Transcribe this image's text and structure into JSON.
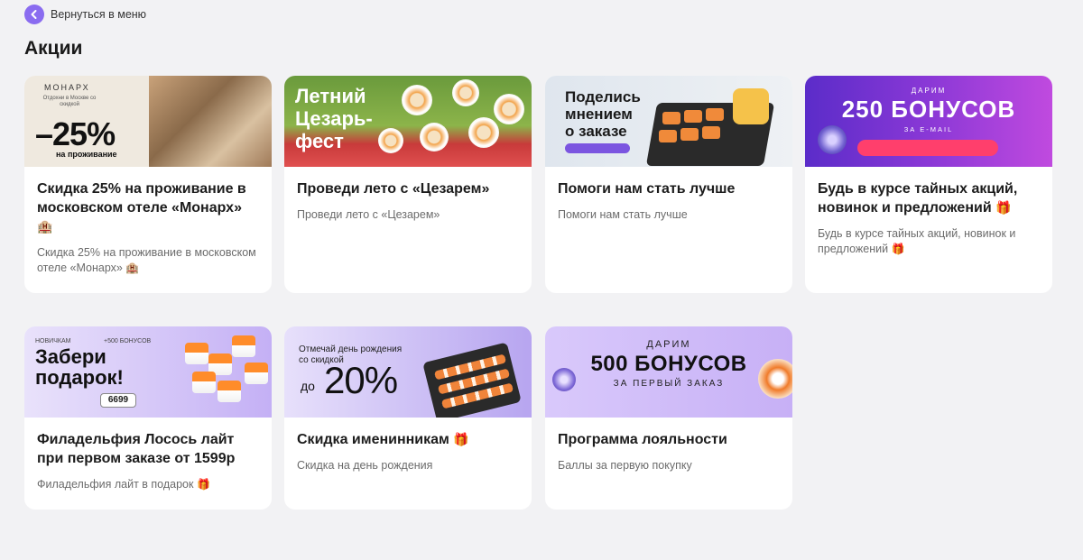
{
  "header": {
    "back_label": "Вернуться в меню",
    "page_title": "Акции"
  },
  "colors": {
    "accent": "#8a6cf0",
    "background": "#f2f2f4",
    "card": "#ffffff"
  },
  "icons": {
    "back": "chevron-left-icon",
    "hotel": "hotel-icon",
    "gift": "gift-icon"
  },
  "promos": [
    {
      "title": "Скидка 25% на проживание в московском отеле «Монарх»",
      "title_emoji": "🏨",
      "desc": "Скидка 25% на проживание в московском отеле «Монарх»",
      "desc_emoji": "🏨",
      "banner": {
        "brand": "МОНАРХ",
        "small": "Отдохни в Москве со скидкой",
        "big": "–25%",
        "sub": "на проживание"
      }
    },
    {
      "title": "Проведи лето с «Цезарем»",
      "desc": "Проведи лето с «Цезарем»",
      "banner": {
        "line1": "Летний",
        "line2": "Цезарь-",
        "line3": "фест"
      }
    },
    {
      "title": "Помоги нам стать лучше",
      "desc": "Помоги нам стать лучше",
      "banner": {
        "line1": "Поделись",
        "line2": "мнением",
        "line3": "о заказе"
      }
    },
    {
      "title": "Будь в курсе тайных акций, новинок и предложений",
      "title_emoji": "🎁",
      "desc": "Будь в курсе тайных акций, новинок и предложений",
      "desc_emoji": "🎁",
      "banner": {
        "top": "ДАРИМ",
        "big": "250 БОНУСОВ",
        "bottom": "ЗА E-MAIL"
      }
    },
    {
      "title": "Филадельфия Лосось лайт при первом заказе от 1599р",
      "desc": "Филадельфия лайт в подарок",
      "desc_emoji": "🎁",
      "banner": {
        "tag": "НОВИЧКАМ",
        "tag2": "+500 БОНУСОВ",
        "line1": "Забери",
        "line2": "подарок!",
        "price": "6699"
      }
    },
    {
      "title": "Скидка именинникам",
      "title_emoji": "🎁",
      "desc": "Скидка на день рождения",
      "banner": {
        "line1": "Отмечай день рождения",
        "line2": "со скидкой",
        "pre": "до",
        "big": "20%"
      }
    },
    {
      "title": "Программа лояльности",
      "desc": "Баллы за первую покупку",
      "banner": {
        "top": "ДАРИМ",
        "big": "500 БОНУСОВ",
        "bottom": "ЗА ПЕРВЫЙ ЗАКАЗ"
      }
    }
  ]
}
